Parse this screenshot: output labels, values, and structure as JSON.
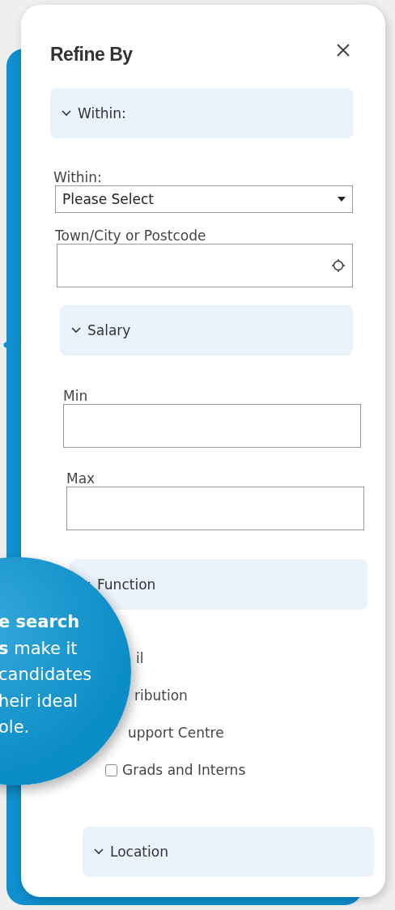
{
  "panel": {
    "title": "Refine By",
    "within_section": {
      "header": "Within:",
      "expanded": true,
      "select_label": "Within:",
      "select_value": "Please Select",
      "location_label": "Town/City or Postcode"
    },
    "salary_section": {
      "header": "Salary",
      "expanded": true,
      "min_label": "Min",
      "max_label": "Max"
    },
    "function_section": {
      "header": "Function",
      "expanded": true,
      "items": [
        {
          "label": "il",
          "kind": "partial"
        },
        {
          "label": "ribution",
          "kind": "partial"
        },
        {
          "label": "upport Centre",
          "kind": "partial"
        },
        {
          "label": "Grads and Interns",
          "kind": "checkbox",
          "checked": false
        }
      ]
    },
    "location_section": {
      "header": "Location",
      "expanded": true
    }
  },
  "callout": {
    "lines": [
      "**e search**",
      "**s** make it",
      "candidates",
      "heir ideal",
      "ole."
    ]
  }
}
